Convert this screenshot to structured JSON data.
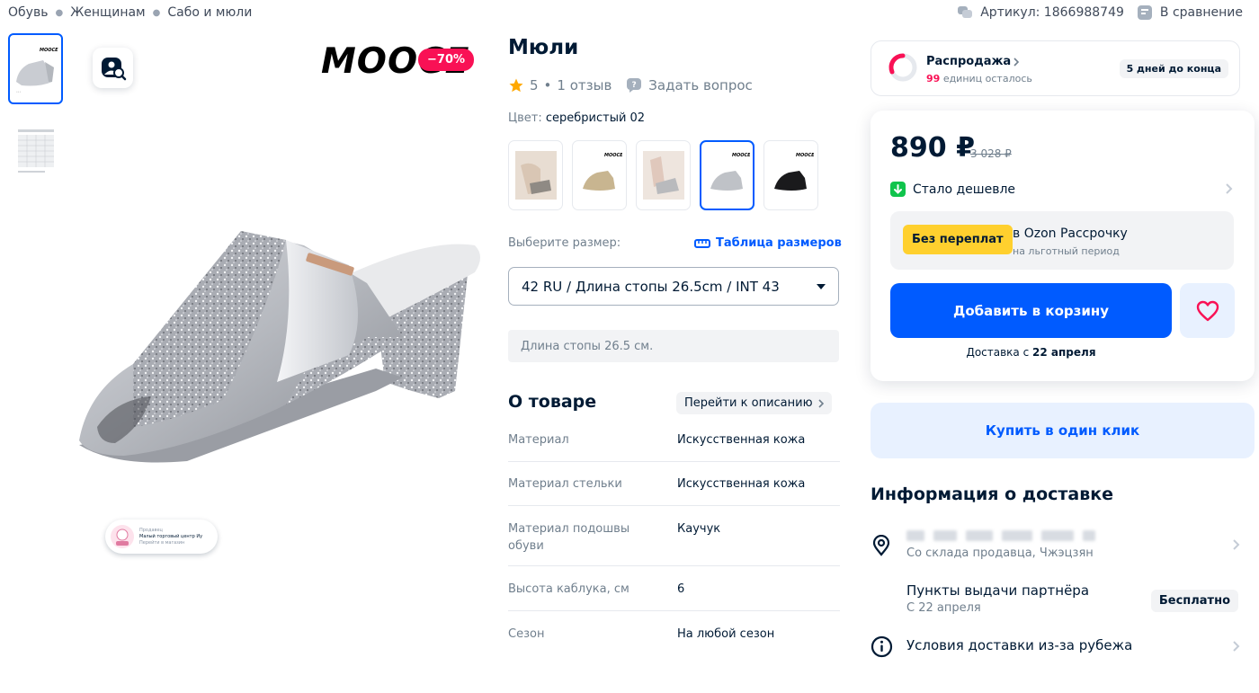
{
  "breadcrumb": [
    "Обувь",
    "Женщинам",
    "Сабо и мюли"
  ],
  "top_right": {
    "article": "Артикул: 1866988749",
    "compare": "В сравнение"
  },
  "gallery": {
    "brand_logo": "MOOCE",
    "discount": "−70%",
    "seller_chip": {
      "label": "Продавец",
      "name": "Малый торговый центр Иу",
      "action": "Перейти в магазин"
    }
  },
  "product": {
    "title": "Мюли",
    "rating": "5",
    "reviews": "1 отзыв",
    "ask_question": "Задать вопрос",
    "color_label": "Цвет:",
    "color_value": "серебристый 02",
    "variant_count_selected": 4,
    "size_label": "Выберите размер:",
    "size_table": "Таблица размеров",
    "size_selected": "42 RU / Длина стопы 26.5cm / INT 43",
    "foot_length_note": "Длина стопы 26.5 см."
  },
  "about": {
    "title": "О товаре",
    "goto_description": "Перейти к описанию",
    "properties": [
      {
        "key": "Материал",
        "value": "Искусственная кожа"
      },
      {
        "key": "Материал стельки",
        "value": "Искусственная кожа"
      },
      {
        "key": "Материал подошвы обуви",
        "value": "Каучук"
      },
      {
        "key": "Высота каблука, см",
        "value": "6"
      },
      {
        "key": "Сезон",
        "value": "На любой сезон"
      }
    ]
  },
  "sale": {
    "title": "Распродажа",
    "units_left_count": "99",
    "units_left_text": "единиц осталось",
    "badge": "5 дней до конца"
  },
  "price_card": {
    "price": "890 ₽",
    "old_price": "3 028 ₽",
    "cheaper": "Стало дешевле",
    "installment_badge": "Без переплат",
    "installment_title": "в Ozon Рассрочку",
    "installment_sub": "на льготный период",
    "add_to_cart": "Добавить в корзину",
    "delivery_prefix": "Доставка с",
    "delivery_date": "22 апреля"
  },
  "one_click": "Купить в один клик",
  "delivery_info": {
    "title": "Информация о доставке",
    "warehouse": "Со склада продавца, Чжэцзян",
    "pickup_title": "Пункты выдачи партнёра",
    "pickup_date": "С 22 апреля",
    "pickup_badge": "Бесплатно",
    "abroad_conditions": "Условия доставки из-за рубежа"
  },
  "colors": {
    "accent": "#005bff",
    "sale_pink": "#f91155",
    "install_yellow": "#ffd02e",
    "text_primary": "#001a34",
    "text_secondary": "#707f8d"
  }
}
